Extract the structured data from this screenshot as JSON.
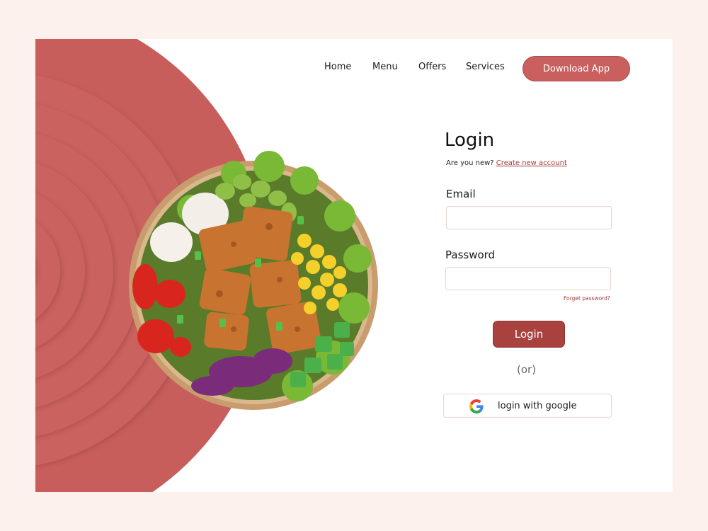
{
  "nav": {
    "links": [
      "Home",
      "Menu",
      "Offers",
      "Services"
    ],
    "download_label": "Download App"
  },
  "login": {
    "title": "Login",
    "prompt": "Are you new?",
    "create_link": "Create new account",
    "email_label": "Email",
    "email_value": "",
    "password_label": "Password",
    "password_value": "",
    "forgot_label": "Forget password?",
    "submit_label": "Login",
    "or_label": "(or)",
    "google_label": "login with google"
  },
  "icons": {
    "google": "google-logo-icon"
  },
  "colors": {
    "page_bg": "#fdf1ee",
    "accent": "#c9605f",
    "accent_dark": "#a9423f",
    "link": "#a53a3a"
  }
}
